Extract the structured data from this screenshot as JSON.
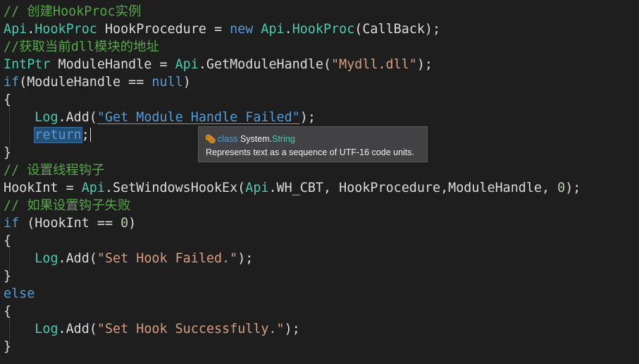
{
  "code_lines": {
    "l1": {
      "comment": "// 创建HookProc实例"
    },
    "l2": {
      "t1": "Api",
      "p1": ".",
      "t2": "HookProc",
      "p2": " HookProcedure = ",
      "k1": "new",
      "p3": " ",
      "t3": "Api",
      "p4": ".",
      "t4": "HookProc",
      "p5": "(CallBack);"
    },
    "l3": {
      "comment": "//获取当前dll模块的地址"
    },
    "l4": {
      "t1": "IntPtr",
      "p1": " ModuleHandle = ",
      "t2": "Api",
      "p2": ".GetModuleHandle(",
      "s1": "\"Mydll.dll\"",
      "p3": ");"
    },
    "l5": {
      "k1": "if",
      "p1": "(ModuleHandle == ",
      "k2": "null",
      "p2": ")"
    },
    "l6": {
      "p1": "{"
    },
    "l7": {
      "indent": "    ",
      "t1": "Log",
      "p1": ".Add(",
      "s1": "\"Get Module Handle Failed\"",
      "p2": ");"
    },
    "l8": {
      "indent": "    ",
      "k1": "return",
      "p1": ";"
    },
    "l9": {
      "p1": "}"
    },
    "l10": {
      "comment": "// 设置线程钩子"
    },
    "l11": {
      "p1": "HookInt = ",
      "t1": "Api",
      "p2": ".SetWindowsHookEx(",
      "t2": "Api",
      "p3": ".WH_CBT, HookProcedure,ModuleHandle, ",
      "n1": "0",
      "p4": ");"
    },
    "l12": {
      "comment": "// 如果设置钩子失败"
    },
    "l13": {
      "k1": "if",
      "p1": " (HookInt == ",
      "n1": "0",
      "p2": ")"
    },
    "l14": {
      "p1": "{"
    },
    "l15": {
      "indent": "    ",
      "t1": "Log",
      "p1": ".Add(",
      "s1": "\"Set Hook Failed.\"",
      "p2": ");"
    },
    "l16": {
      "p1": "}"
    },
    "l17": {
      "k1": "else"
    },
    "l18": {
      "p1": "{"
    },
    "l19": {
      "indent": "    ",
      "t1": "Log",
      "p1": ".Add(",
      "s1": "\"Set Hook Successfully.\"",
      "p2": ");"
    },
    "l20": {
      "p1": "}"
    }
  },
  "tooltip": {
    "icon": "class-icon",
    "keyword": "class",
    "namespace": "System.",
    "type_name": "String",
    "description": "Represents text as a sequence of UTF-16 code units."
  },
  "colors": {
    "background": "#1e1e1e",
    "comment": "#57a64a",
    "type": "#4ec9b0",
    "keyword": "#569cd6",
    "string": "#d69d85",
    "number": "#b5cea8",
    "plain": "#dcdcdc",
    "selection": "#264f78",
    "tooltip_bg": "#424245"
  }
}
